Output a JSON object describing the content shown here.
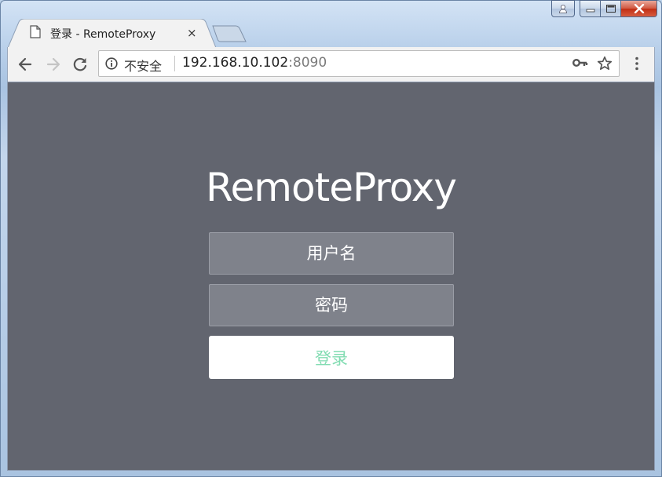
{
  "browser": {
    "tab_title": "登录 - RemoteProxy",
    "tab_close": "×",
    "security_label": "不安全",
    "url_host": "192.168.10.102",
    "url_port": ":8090"
  },
  "page": {
    "app_title": "RemoteProxy",
    "username_placeholder": "用户名",
    "password_placeholder": "密码",
    "login_label": "登录"
  },
  "colors": {
    "page_background": "#62656f",
    "input_background": "#7f828b",
    "login_text": "#82dcb2"
  }
}
